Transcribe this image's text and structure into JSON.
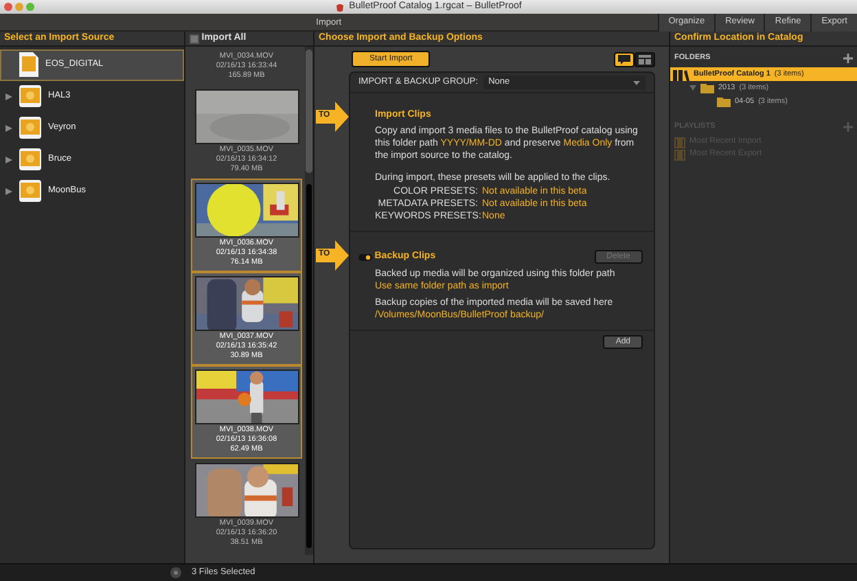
{
  "window": {
    "title": "BulletProof Catalog 1.rgcat – BulletProof"
  },
  "toolbar": {
    "title": "Import",
    "tabs": [
      {
        "label": "Organize",
        "selected": false
      },
      {
        "label": "Review",
        "selected": false
      },
      {
        "label": "Refine",
        "selected": false
      },
      {
        "label": "Export",
        "selected": false
      }
    ]
  },
  "sources": {
    "header": "Select an Import Source",
    "items": [
      {
        "name": "EOS_DIGITAL",
        "kind": "card",
        "selected": true
      },
      {
        "name": "HAL3",
        "kind": "drive",
        "selected": false
      },
      {
        "name": "Veyron",
        "kind": "drive",
        "selected": false
      },
      {
        "name": "Bruce",
        "kind": "drive",
        "selected": false
      },
      {
        "name": "MoonBus",
        "kind": "drive",
        "selected": false
      }
    ]
  },
  "clips": {
    "import_all": {
      "label": "Import All",
      "checked": false
    },
    "items": [
      {
        "name": "MVI_0034.MOV",
        "date": "02/16/13 16:33:44",
        "size": "165.89 MB",
        "selected": false
      },
      {
        "name": "MVI_0035.MOV",
        "date": "02/16/13 16:34:12",
        "size": "79.40 MB",
        "selected": false,
        "kind": "picture"
      },
      {
        "name": "MVI_0036.MOV",
        "date": "02/16/13 16:34:38",
        "size": "76.14 MB",
        "selected": true,
        "kind": "picture"
      },
      {
        "name": "MVI_0037.MOV",
        "date": "02/16/13 16:35:42",
        "size": "30.89 MB",
        "selected": true,
        "kind": "picture"
      },
      {
        "name": "MVI_0038.MOV",
        "date": "02/16/13 16:36:08",
        "size": "62.49 MB",
        "selected": true,
        "kind": "picture"
      },
      {
        "name": "MVI_0039.MOV",
        "date": "02/16/13 16:36:20",
        "size": "38.51 MB",
        "selected": false,
        "kind": "picture"
      }
    ]
  },
  "options": {
    "header": "Choose Import and Backup Options",
    "start_button": "Start Import",
    "views": [
      {
        "selected": true
      },
      {
        "selected": false
      }
    ],
    "group": {
      "label": "IMPORT & BACKUP GROUP:",
      "value": "None"
    },
    "import": {
      "badge": "TO",
      "title": "Import Clips",
      "text": "Copy and import 3 media files to the BulletProof catalog using this folder path **YYYY/MM-DD** and preserve **Media Only** from the import source to the catalog.",
      "presets_intro": "During import, these presets will be applied to the clips.",
      "presets": [
        {
          "label": "COLOR PRESETS:",
          "value": "Not available in this beta"
        },
        {
          "label": "METADATA PRESETS:",
          "value": "Not available in this beta"
        },
        {
          "label": "KEYWORDS PRESETS:",
          "value": "None"
        }
      ]
    },
    "backup": {
      "badge": "TO",
      "title": "Backup Clips",
      "on": true,
      "delete_button": "Delete",
      "delete_disabled": true,
      "text": "Backed up media will be organized using this folder path",
      "path_rule": "Use same folder path as import",
      "save_text": "Backup copies of the imported media will be saved here",
      "save_path": "/Volumes/MoonBus/BulletProof backup/"
    },
    "add_button": "Add"
  },
  "location": {
    "header": "Confirm Location in Catalog",
    "folders_label": "FOLDERS",
    "folders": [
      {
        "name": "BulletProof Catalog 1",
        "count": "(3 items)",
        "selected": true,
        "children": [
          {
            "name": "2013",
            "count": "(3 items)",
            "selected": false,
            "expanded": true,
            "children": [
              {
                "name": "04-05",
                "count": "(3 items)",
                "selected": false,
                "expanded": false
              }
            ]
          }
        ]
      }
    ],
    "playlists_label": "PLAYLISTS",
    "playlists": [
      {
        "name": "Most Recent Import",
        "disabled": true
      },
      {
        "name": "Most Recent Export",
        "disabled": true
      }
    ]
  },
  "status_bar": {
    "text": "3 Files Selected"
  }
}
